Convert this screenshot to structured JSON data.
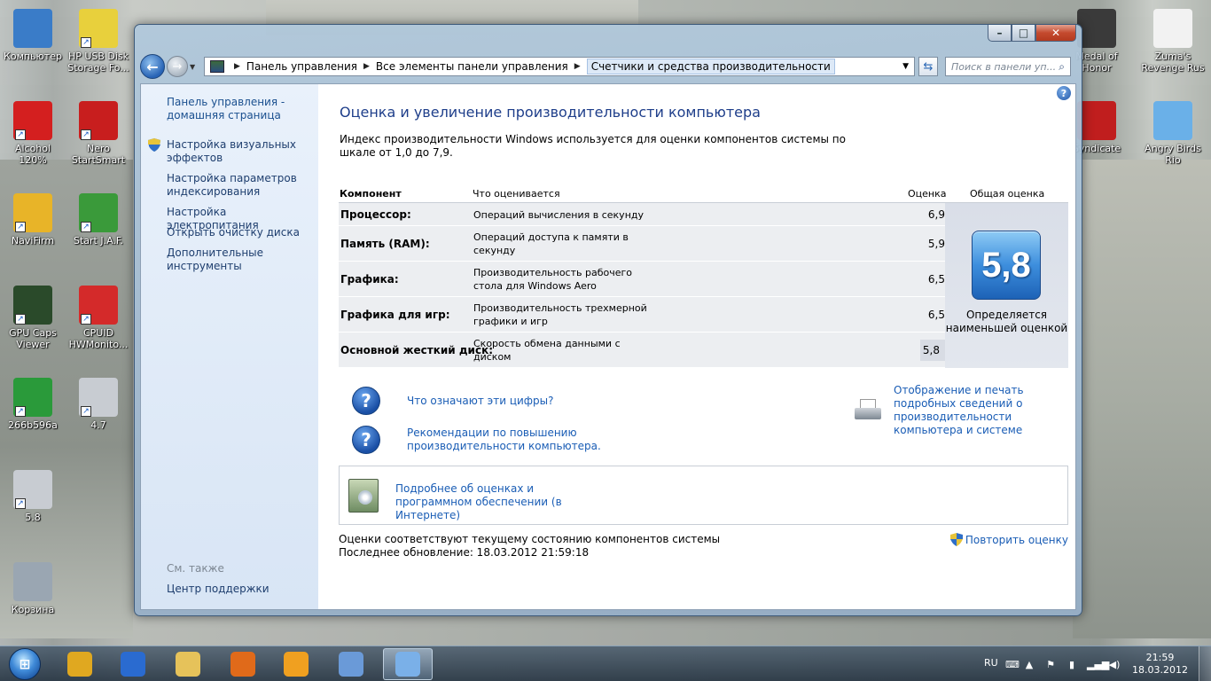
{
  "desktop": {
    "icons_left": [
      {
        "label": "Компьютер",
        "color": "#3a7cc8"
      },
      {
        "label": "HP USB Disk Storage Fo...",
        "color": "#e8d03c"
      },
      {
        "label": "Alcohol 120%",
        "color": "#d41f1f"
      },
      {
        "label": "Nero StartSmart",
        "color": "#c81e1e"
      },
      {
        "label": "NaviFirm",
        "color": "#e8b428"
      },
      {
        "label": "Start J.A.F.",
        "color": "#3a9a3a"
      },
      {
        "label": "GPU Caps Viewer",
        "color": "#2a4a2a"
      },
      {
        "label": "CPUID HWMonito...",
        "color": "#d42a2a"
      },
      {
        "label": "266b596a",
        "color": "#2a9a3a"
      },
      {
        "label": "4.7",
        "color": "#c8ccd2"
      },
      {
        "label": "5.8",
        "color": "#c8ccd2"
      },
      {
        "label": "Корзина",
        "color": "#9aa6b2"
      }
    ],
    "icons_right": [
      {
        "label": "Medal of Honor",
        "color": "#3a3a3a"
      },
      {
        "label": "Zuma's Revenge Rus",
        "color": "#f2f2f2"
      },
      {
        "label": "Syndicate",
        "color": "#c01e1e"
      },
      {
        "label": "Angry Birds Rio",
        "color": "#6ab0e8"
      }
    ]
  },
  "window": {
    "caption": {
      "minimize": "–",
      "maximize": "□",
      "close": "✕"
    },
    "address": {
      "crumbs": [
        "Панель управления",
        "Все элементы панели управления"
      ],
      "current": "Счетчики и средства производительности"
    },
    "search_placeholder": "Поиск в панели уп...",
    "sidebar": {
      "home": "Панель управления - домашняя страница",
      "links": [
        "Настройка визуальных эффектов",
        "Настройка параметров индексирования",
        "Настройка электропитания",
        "Открыть очистку диска",
        "Дополнительные инструменты"
      ],
      "see_also": "См. также",
      "support": "Центр поддержки"
    },
    "main": {
      "title": "Оценка и увеличение производительности компьютера",
      "description": "Индекс производительности Windows используется для оценки компонентов системы по шкале от 1,0 до 7,9.",
      "table": {
        "headers": {
          "component": "Компонент",
          "what": "Что оценивается",
          "score": "Оценка",
          "overall": "Общая оценка"
        },
        "rows": [
          {
            "component": "Процессор:",
            "what": "Операций вычисления в секунду",
            "score": "6,9"
          },
          {
            "component": "Память (RAM):",
            "what": "Операций доступа к памяти в секунду",
            "score": "5,9"
          },
          {
            "component": "Графика:",
            "what": "Производительность рабочего стола для Windows Aero",
            "score": "6,5"
          },
          {
            "component": "Графика для игр:",
            "what": "Производительность трехмерной графики и игр",
            "score": "6,5"
          },
          {
            "component": "Основной жесткий диск:",
            "what": "Скорость обмена данными с диском",
            "score": "5,8"
          }
        ],
        "overall_score": "5,8",
        "overall_caption": "Определяется наименьшей оценкой"
      },
      "links": {
        "what_numbers": "Что означают эти цифры?",
        "recommendations": "Рекомендации по повышению производительности компьютера.",
        "print_details": "Отображение и печать подробных сведений о производительности компьютера и системе",
        "online_info": "Подробнее об оценках и программном обеспечении (в Интернете)"
      },
      "status_line1": "Оценки соответствуют текущему состоянию компонентов системы",
      "status_line2": "Последнее обновление: 18.03.2012 21:59:18",
      "rerun": "Повторить оценку"
    }
  },
  "taskbar": {
    "start_icon": "windows-orb-icon",
    "pinned": [
      {
        "name": "tb-icon-1",
        "color": "#e0a820"
      },
      {
        "name": "tb-icon-2",
        "color": "#2a6bd0"
      },
      {
        "name": "tb-icon-3",
        "color": "#e6c25a"
      },
      {
        "name": "tb-icon-4",
        "color": "#e06a1a"
      },
      {
        "name": "tb-icon-5",
        "color": "#f0a020"
      },
      {
        "name": "tb-icon-6",
        "color": "#6a9ad8"
      },
      {
        "name": "tb-icon-7",
        "color": "#7ab0e8"
      }
    ],
    "language": "RU",
    "time": "21:59",
    "date": "18.03.2012"
  }
}
